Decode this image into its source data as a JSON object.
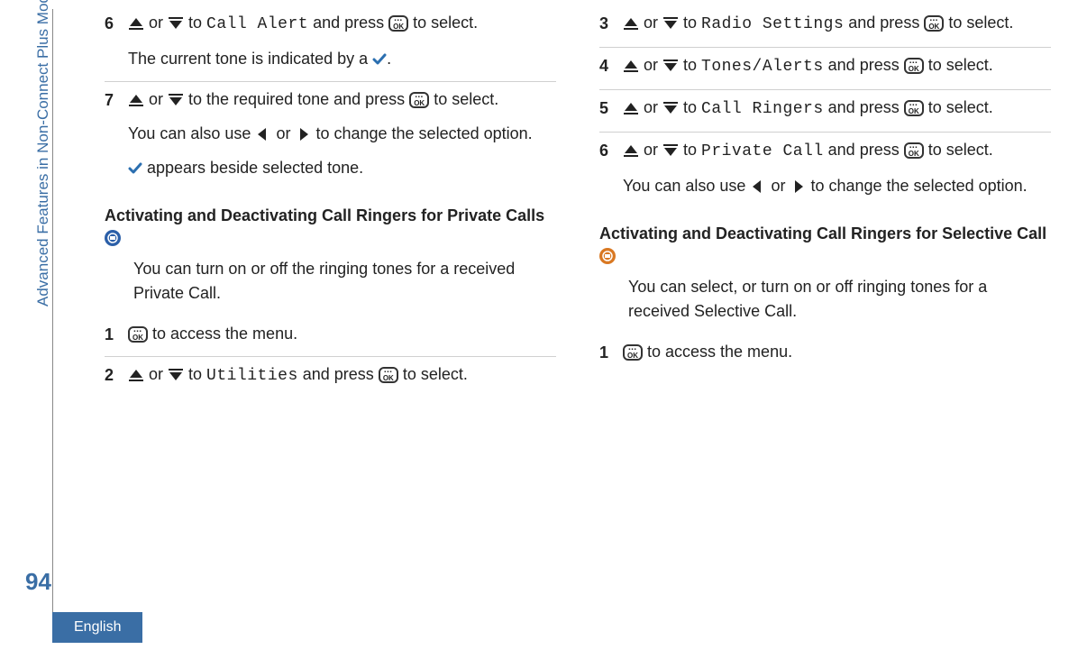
{
  "side_label": "Advanced Features in Non-Connect Plus Mode",
  "page_number": "94",
  "language": "English",
  "left": {
    "step6": {
      "num": "6",
      "or": " or ",
      "to": " to ",
      "menu": "Call Alert",
      "and_press": " and press ",
      "to_select": " to select.",
      "line2a": "The current tone is indicated by a ",
      "line2b": "."
    },
    "step7": {
      "num": "7",
      "or": " or ",
      "to_req": " to the required tone and press ",
      "to_select": " to select.",
      "line2a": "You can also use ",
      "line2_or": " or ",
      "line2b": " to change the selected option.",
      "line3": " appears beside selected tone."
    },
    "heading1a": "Activating and Deactivating Call Ringers for Private Calls ",
    "intro1": "You can turn on or off the ringing tones for a received Private Call.",
    "pc_step1": {
      "num": "1",
      "txt": " to access the menu."
    },
    "pc_step2": {
      "num": "2",
      "or": " or ",
      "to": " to ",
      "menu": "Utilities",
      "and_press": " and press ",
      "to_select": " to select."
    }
  },
  "right": {
    "step3": {
      "num": "3",
      "or": " or ",
      "to": " to ",
      "menu": "Radio Settings",
      "and_press": " and press ",
      "to_select": " to select."
    },
    "step4": {
      "num": "4",
      "or": " or ",
      "to": " to ",
      "menu": "Tones/Alerts",
      "and_press": " and press ",
      "to_select": " to select."
    },
    "step5": {
      "num": "5",
      "or": " or ",
      "to": " to ",
      "menu": "Call Ringers",
      "and_press": " and press ",
      "to_select": " to select."
    },
    "step6": {
      "num": "6",
      "or": " or ",
      "to": " to ",
      "menu": "Private Call",
      "and_press": " and press ",
      "to_select": " to select.",
      "line2a": "You can also use ",
      "line2_or": " or ",
      "line2b": " to change the selected option."
    },
    "heading2a": "Activating and Deactivating Call Ringers for Selective Call ",
    "intro2": "You can select, or turn on or off ringing tones for a received Selective Call.",
    "sc_step1": {
      "num": "1",
      "txt": " to access the menu."
    }
  }
}
